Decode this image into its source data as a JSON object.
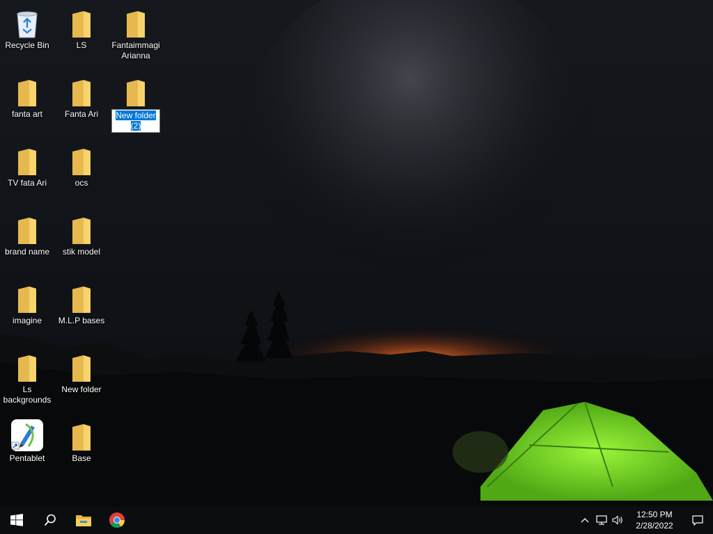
{
  "desktop": {
    "icons": [
      {
        "label": "Recycle Bin",
        "type": "recycle-bin"
      },
      {
        "label": "LS",
        "type": "folder"
      },
      {
        "label": "Fantaimmagi Arianna",
        "type": "folder"
      },
      {
        "label": "fanta art",
        "type": "folder"
      },
      {
        "label": "Fanta Ari",
        "type": "folder"
      },
      {
        "label": "New folder (2)",
        "type": "folder",
        "renaming": true
      },
      {
        "label": "TV  fata Ari",
        "type": "folder"
      },
      {
        "label": "ocs",
        "type": "folder"
      },
      {
        "label": "brand name",
        "type": "folder"
      },
      {
        "label": "stik  model",
        "type": "folder"
      },
      {
        "label": "imagine",
        "type": "folder"
      },
      {
        "label": "M.L.P bases",
        "type": "folder"
      },
      {
        "label": "Ls backgrounds",
        "type": "folder"
      },
      {
        "label": "New folder",
        "type": "folder"
      },
      {
        "label": "Pentablet",
        "type": "app-shortcut"
      },
      {
        "label": "Base",
        "type": "folder"
      }
    ]
  },
  "taskbar": {
    "pinned": [
      "windows-start-icon",
      "search-icon",
      "file-explorer-icon",
      "chrome-icon"
    ],
    "tray": [
      "chevron-up-icon",
      "network-icon",
      "volume-icon"
    ],
    "clock": {
      "time": "12:50 PM",
      "date": "2/28/2022"
    },
    "accent": "#0078d7"
  }
}
